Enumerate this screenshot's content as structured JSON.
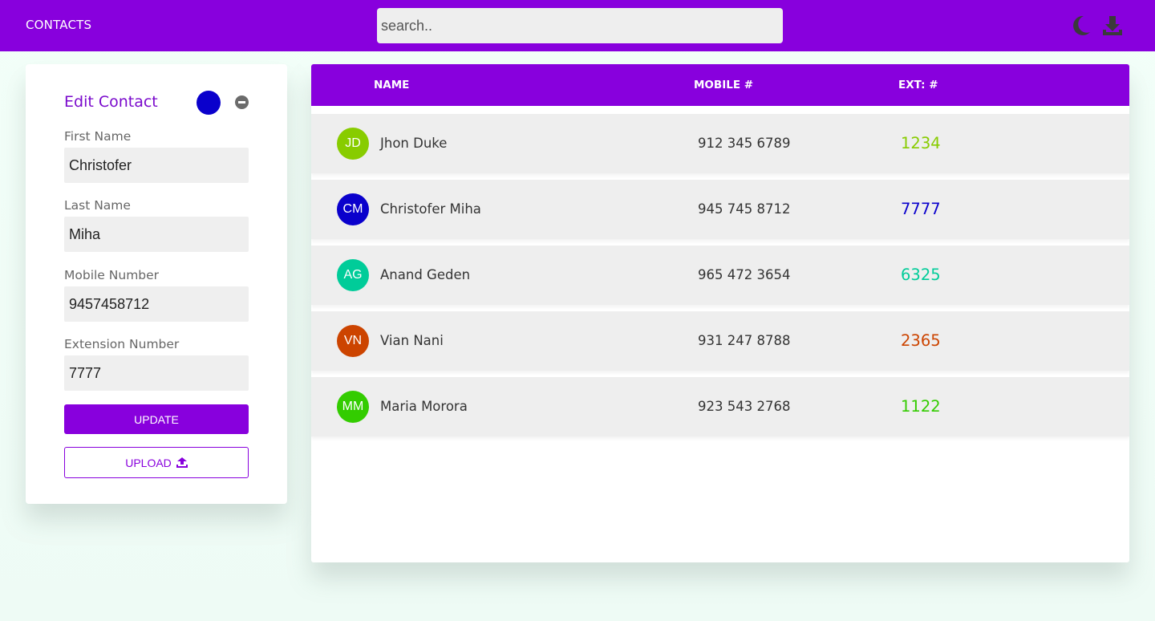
{
  "header": {
    "title": "CONTACTS",
    "search_placeholder": "search..",
    "search_value": ""
  },
  "edit_panel": {
    "title": "Edit Contact",
    "selected_color": "#0a00cc",
    "fields": [
      {
        "label": "First Name",
        "value": "Christofer"
      },
      {
        "label": "Last Name",
        "value": "Miha"
      },
      {
        "label": "Mobile Number",
        "value": "9457458712"
      },
      {
        "label": "Extension Number",
        "value": "7777"
      }
    ],
    "update_label": "UPDATE",
    "upload_label": "UPLOAD"
  },
  "table": {
    "columns": [
      "NAME",
      "MOBILE #",
      "EXT: #"
    ],
    "rows": [
      {
        "initials": "JD",
        "name": "Jhon Duke",
        "mobile": "912 345 6789",
        "ext": "1234",
        "color": "#88cc00"
      },
      {
        "initials": "CM",
        "name": "Christofer Miha",
        "mobile": "945 745 8712",
        "ext": "7777",
        "color": "#0a00cc"
      },
      {
        "initials": "AG",
        "name": "Anand Geden",
        "mobile": "965 472 3654",
        "ext": "6325",
        "color": "#00cc99"
      },
      {
        "initials": "VN",
        "name": "Vian Nani",
        "mobile": "931 247 8788",
        "ext": "2365",
        "color": "#cc4400"
      },
      {
        "initials": "MM",
        "name": "Maria Morora",
        "mobile": "923 543 2768",
        "ext": "1122",
        "color": "#33cc00"
      }
    ]
  },
  "colors": {
    "accent": "#8800dd",
    "background": "#f3fff9"
  },
  "icons": {
    "theme_toggle": "moon-icon",
    "download": "download-icon",
    "remove": "minus-circle-icon",
    "upload": "upload-icon"
  }
}
